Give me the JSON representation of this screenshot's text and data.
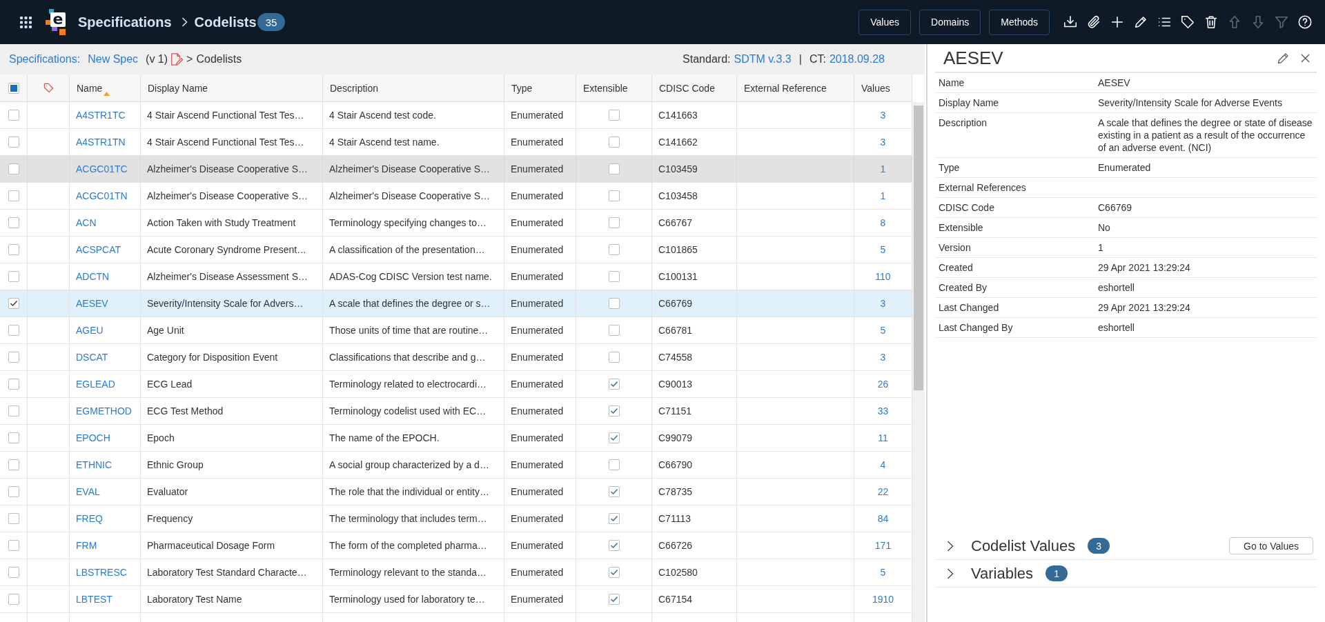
{
  "app_bar": {
    "logo_letter": "e",
    "title": "Specifications",
    "page": "Codelists",
    "count": "35",
    "buttons": [
      "Values",
      "Domains",
      "Methods"
    ],
    "tools": [
      {
        "kind": "download",
        "disabled": false
      },
      {
        "kind": "attach",
        "disabled": false
      },
      {
        "kind": "add",
        "disabled": false
      },
      {
        "kind": "edit",
        "disabled": false
      },
      {
        "kind": "list",
        "disabled": false
      },
      {
        "kind": "tag",
        "disabled": false
      },
      {
        "kind": "delete",
        "disabled": false
      },
      {
        "kind": "up",
        "disabled": true
      },
      {
        "kind": "down",
        "disabled": true
      },
      {
        "kind": "filter",
        "disabled": true
      },
      {
        "kind": "help",
        "disabled": false
      }
    ]
  },
  "breadcrumb": {
    "root": "Specifications:",
    "spec": "New Spec",
    "version": "(v 1)",
    "separator": ">",
    "current": "Codelists",
    "standard_label": "Standard:",
    "standard": "SDTM v.3.3",
    "divider": "|",
    "ct_label": "CT:",
    "ct": "2018.09.28"
  },
  "table": {
    "select_all": {
      "indeterminate": true
    },
    "columns": [
      {
        "label": "Name",
        "sorted": true
      },
      {
        "label": "Display Name",
        "sorted": false
      },
      {
        "label": "Description",
        "sorted": false
      },
      {
        "label": "Type",
        "sorted": false
      },
      {
        "label": "Extensible",
        "sorted": false
      },
      {
        "label": "CDISC Code",
        "sorted": false
      },
      {
        "label": "External Reference",
        "sorted": false
      },
      {
        "label": "Values",
        "sorted": false
      }
    ],
    "rows": [
      {
        "selected": false,
        "hovered": false,
        "name": "A4STR1TC",
        "display_name": "4 Stair Ascend Functional Test Tes…",
        "description": "4 Stair Ascend test code.",
        "type": "Enumerated",
        "extensible": false,
        "cdisc_code": "C141663",
        "values": "3"
      },
      {
        "selected": false,
        "hovered": false,
        "name": "A4STR1TN",
        "display_name": "4 Stair Ascend Functional Test Tes…",
        "description": "4 Stair Ascend test name.",
        "type": "Enumerated",
        "extensible": false,
        "cdisc_code": "C141662",
        "values": "3"
      },
      {
        "selected": false,
        "hovered": true,
        "name": "ACGC01TC",
        "display_name": "Alzheimer's Disease Cooperative S…",
        "description": "Alzheimer's Disease Cooperative S…",
        "type": "Enumerated",
        "extensible": false,
        "cdisc_code": "C103459",
        "values": "1"
      },
      {
        "selected": false,
        "hovered": false,
        "name": "ACGC01TN",
        "display_name": "Alzheimer's Disease Cooperative S…",
        "description": "Alzheimer's Disease Cooperative S…",
        "type": "Enumerated",
        "extensible": false,
        "cdisc_code": "C103458",
        "values": "1"
      },
      {
        "selected": false,
        "hovered": false,
        "name": "ACN",
        "display_name": "Action Taken with Study Treatment",
        "description": "Terminology specifying changes to…",
        "type": "Enumerated",
        "extensible": false,
        "cdisc_code": "C66767",
        "values": "8"
      },
      {
        "selected": false,
        "hovered": false,
        "name": "ACSPCAT",
        "display_name": "Acute Coronary Syndrome Present…",
        "description": "A classification of the presentation…",
        "type": "Enumerated",
        "extensible": false,
        "cdisc_code": "C101865",
        "values": "5"
      },
      {
        "selected": false,
        "hovered": false,
        "name": "ADCTN",
        "display_name": "Alzheimer's Disease Assessment S…",
        "description": "ADAS-Cog CDISC Version test name.",
        "type": "Enumerated",
        "extensible": false,
        "cdisc_code": "C100131",
        "values": "110"
      },
      {
        "selected": true,
        "hovered": false,
        "name": "AESEV",
        "display_name": "Severity/Intensity Scale for Advers…",
        "description": "A scale that defines the degree or s…",
        "type": "Enumerated",
        "extensible": false,
        "cdisc_code": "C66769",
        "values": "3"
      },
      {
        "selected": false,
        "hovered": false,
        "name": "AGEU",
        "display_name": "Age Unit",
        "description": "Those units of time that are routine…",
        "type": "Enumerated",
        "extensible": false,
        "cdisc_code": "C66781",
        "values": "5"
      },
      {
        "selected": false,
        "hovered": false,
        "name": "DSCAT",
        "display_name": "Category for Disposition Event",
        "description": "Classifications that describe and g…",
        "type": "Enumerated",
        "extensible": false,
        "cdisc_code": "C74558",
        "values": "3"
      },
      {
        "selected": false,
        "hovered": false,
        "name": "EGLEAD",
        "display_name": "ECG Lead",
        "description": "Terminology related to electrocardi…",
        "type": "Enumerated",
        "extensible": true,
        "cdisc_code": "C90013",
        "values": "26"
      },
      {
        "selected": false,
        "hovered": false,
        "name": "EGMETHOD",
        "display_name": "ECG Test Method",
        "description": "Terminology codelist used with EC…",
        "type": "Enumerated",
        "extensible": true,
        "cdisc_code": "C71151",
        "values": "33"
      },
      {
        "selected": false,
        "hovered": false,
        "name": "EPOCH",
        "display_name": "Epoch",
        "description": "The name of the EPOCH.",
        "type": "Enumerated",
        "extensible": true,
        "cdisc_code": "C99079",
        "values": "11"
      },
      {
        "selected": false,
        "hovered": false,
        "name": "ETHNIC",
        "display_name": "Ethnic Group",
        "description": "A social group characterized by a d…",
        "type": "Enumerated",
        "extensible": false,
        "cdisc_code": "C66790",
        "values": "4"
      },
      {
        "selected": false,
        "hovered": false,
        "name": "EVAL",
        "display_name": "Evaluator",
        "description": "The role that the individual or entity…",
        "type": "Enumerated",
        "extensible": true,
        "cdisc_code": "C78735",
        "values": "22"
      },
      {
        "selected": false,
        "hovered": false,
        "name": "FREQ",
        "display_name": "Frequency",
        "description": "The terminology that includes term…",
        "type": "Enumerated",
        "extensible": true,
        "cdisc_code": "C71113",
        "values": "84"
      },
      {
        "selected": false,
        "hovered": false,
        "name": "FRM",
        "display_name": "Pharmaceutical Dosage Form",
        "description": "The form of the completed pharma…",
        "type": "Enumerated",
        "extensible": true,
        "cdisc_code": "C66726",
        "values": "171"
      },
      {
        "selected": false,
        "hovered": false,
        "name": "LBSTRESC",
        "display_name": "Laboratory Test Standard Characte…",
        "description": "Terminology relevant to the standa…",
        "type": "Enumerated",
        "extensible": true,
        "cdisc_code": "C102580",
        "values": "5"
      },
      {
        "selected": false,
        "hovered": false,
        "name": "LBTEST",
        "display_name": "Laboratory Test Name",
        "description": "Terminology used for laboratory te…",
        "type": "Enumerated",
        "extensible": true,
        "cdisc_code": "C67154",
        "values": "1910"
      }
    ]
  },
  "panel": {
    "title": "AESEV",
    "properties": [
      {
        "label": "Name",
        "value": "AESEV"
      },
      {
        "label": "Display Name",
        "value": "Severity/Intensity Scale for Adverse Events"
      },
      {
        "label": "Description",
        "value": "A scale that defines the degree or state of disease existing in a patient as a result of the occurrence of an adverse event. (NCI)"
      },
      {
        "label": "Type",
        "value": "Enumerated"
      },
      {
        "label": "External References"
      },
      {
        "label": "CDISC Code",
        "value": "C66769"
      },
      {
        "label": "Extensible",
        "value": "No"
      },
      {
        "label": "Version",
        "value": "1"
      },
      {
        "label": "Created",
        "value": "29 Apr 2021 13:29:24"
      },
      {
        "label": "Created By",
        "value": "eshortell"
      },
      {
        "label": "Last Changed",
        "value": "29 Apr 2021 13:29:24"
      },
      {
        "label": "Last Changed By",
        "value": "eshortell"
      }
    ],
    "sections": [
      {
        "title": "Codelist Values",
        "count": "3",
        "expanded": false,
        "action": "Go to Values"
      },
      {
        "title": "Variables",
        "count": "1",
        "expanded": false
      }
    ]
  }
}
